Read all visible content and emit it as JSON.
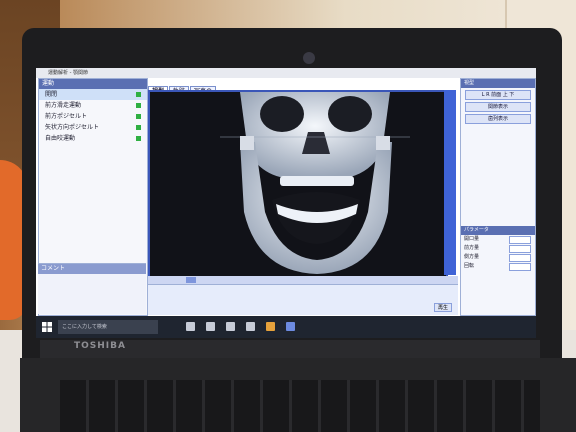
{
  "window": {
    "title": "運動解析 - 顎関節"
  },
  "left_panel": {
    "header": "運動",
    "items": [
      {
        "label": "開閉",
        "selected": true
      },
      {
        "label": "前方滑走運動",
        "selected": false
      },
      {
        "label": "前方ポジセルト",
        "selected": false
      },
      {
        "label": "矢状方向ポジセルト",
        "selected": false
      },
      {
        "label": "自由咬運動",
        "selected": false
      }
    ],
    "comment_header": "コメント"
  },
  "viewer": {
    "tabs": [
      "視型",
      "軌跡",
      "写真の"
    ]
  },
  "right_panel": {
    "header": "視型",
    "buttons": [
      "L R 前面 上 下",
      "関節表示",
      "歯列表示"
    ],
    "params_header": "パラメータ",
    "param_labels": [
      "開口量",
      "前方量",
      "側方量",
      "回転"
    ]
  },
  "bottom_bar": {
    "play_label": "再生"
  },
  "taskbar": {
    "search_placeholder": "ここに入力して検索"
  },
  "hardware": {
    "brand": "TOSHIBA"
  },
  "colors": {
    "accent": "#3f63d6",
    "header": "#5a6fb2",
    "viewer_bg": "#111218",
    "check": "#2fb042"
  }
}
